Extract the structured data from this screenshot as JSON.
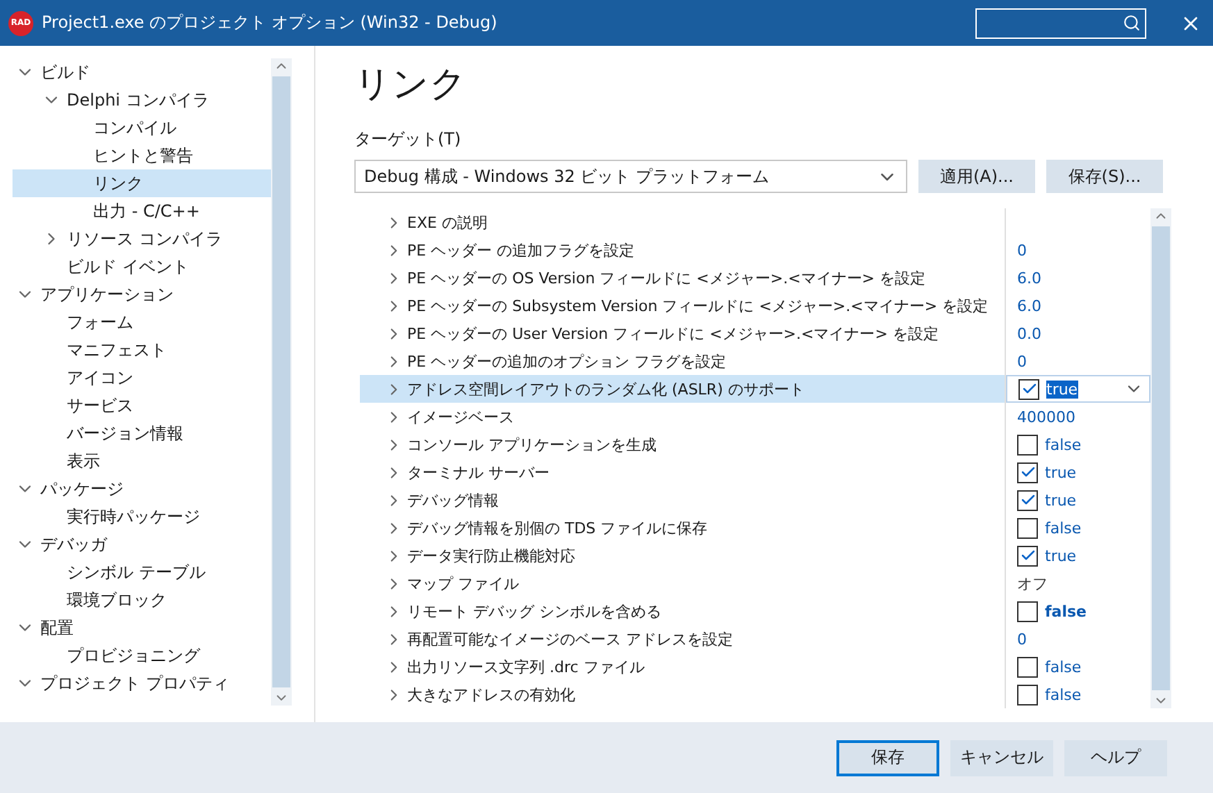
{
  "window": {
    "logo": "RAD",
    "title": "Project1.exe のプロジェクト オプション  (Win32 - Debug)"
  },
  "sidebar": {
    "items": [
      {
        "label": "ビルド",
        "selected": false,
        "expanded": true,
        "children": [
          {
            "label": "Delphi コンパイラ",
            "selected": false,
            "expanded": true,
            "children": [
              {
                "label": "コンパイル",
                "selected": false
              },
              {
                "label": "ヒントと警告",
                "selected": false
              },
              {
                "label": "リンク",
                "selected": true
              },
              {
                "label": "出力 - C/C++",
                "selected": false
              }
            ]
          },
          {
            "label": "リソース コンパイラ",
            "selected": false,
            "expanded": false
          },
          {
            "label": "ビルド イベント",
            "selected": false
          }
        ]
      },
      {
        "label": "アプリケーション",
        "selected": false,
        "expanded": true,
        "children": [
          {
            "label": "フォーム",
            "selected": false
          },
          {
            "label": "マニフェスト",
            "selected": false
          },
          {
            "label": "アイコン",
            "selected": false
          },
          {
            "label": "サービス",
            "selected": false
          },
          {
            "label": "バージョン情報",
            "selected": false
          },
          {
            "label": "表示",
            "selected": false
          }
        ]
      },
      {
        "label": "パッケージ",
        "selected": false,
        "expanded": true,
        "children": [
          {
            "label": "実行時パッケージ",
            "selected": false
          }
        ]
      },
      {
        "label": "デバッガ",
        "selected": false,
        "expanded": true,
        "children": [
          {
            "label": "シンボル テーブル",
            "selected": false
          },
          {
            "label": "環境ブロック",
            "selected": false
          }
        ]
      },
      {
        "label": "配置",
        "selected": false,
        "expanded": true,
        "children": [
          {
            "label": "プロビジョニング",
            "selected": false
          }
        ]
      },
      {
        "label": "プロジェクト プロパティ",
        "selected": false,
        "expanded": true
      }
    ]
  },
  "page": {
    "heading": "リンク",
    "target_label": "ターゲット(T)",
    "target_value": "Debug 構成 - Windows 32 ビット プラットフォーム",
    "buttons": [
      "適用(A)...",
      "保存(S)..."
    ]
  },
  "properties": [
    {
      "name": "EXE の説明",
      "kind": "none",
      "selected": false
    },
    {
      "name": "PE ヘッダー の追加フラグを設定",
      "kind": "number",
      "value": "0",
      "selected": false
    },
    {
      "name": "PE ヘッダーの OS Version フィールドに <メジャー>.<マイナー> を設定",
      "kind": "number",
      "value": "6.0",
      "selected": false
    },
    {
      "name": "PE ヘッダーの Subsystem Version フィールドに <メジャー>.<マイナー> を設定",
      "kind": "number",
      "value": "6.0",
      "selected": false
    },
    {
      "name": "PE ヘッダーの User Version フィールドに <メジャー>.<マイナー> を設定",
      "kind": "number",
      "value": "0.0",
      "selected": false
    },
    {
      "name": "PE ヘッダーの追加のオプション フラグを設定",
      "kind": "number",
      "value": "0",
      "selected": false
    },
    {
      "name": "アドレス空間レイアウトのランダム化 (ASLR) のサポート",
      "kind": "check",
      "value": "true",
      "checked": true,
      "bold": false,
      "selected": true
    },
    {
      "name": "イメージベース",
      "kind": "number",
      "value": "400000",
      "selected": false
    },
    {
      "name": "コンソール アプリケーションを生成",
      "kind": "check",
      "value": "false",
      "checked": false,
      "bold": false,
      "selected": false
    },
    {
      "name": "ターミナル サーバー",
      "kind": "check",
      "value": "true",
      "checked": true,
      "bold": false,
      "selected": false
    },
    {
      "name": "デバッグ情報",
      "kind": "check",
      "value": "true",
      "checked": true,
      "bold": false,
      "selected": false
    },
    {
      "name": "デバッグ情報を別個の TDS ファイルに保存",
      "kind": "check",
      "value": "false",
      "checked": false,
      "bold": false,
      "selected": false
    },
    {
      "name": "データ実行防止機能対応",
      "kind": "check",
      "value": "true",
      "checked": true,
      "bold": false,
      "selected": false
    },
    {
      "name": "マップ ファイル",
      "kind": "text",
      "value": "オフ",
      "selected": false
    },
    {
      "name": "リモート デバッグ シンボルを含める",
      "kind": "check",
      "value": "false",
      "checked": false,
      "bold": true,
      "selected": false
    },
    {
      "name": "再配置可能なイメージのベース アドレスを設定",
      "kind": "number",
      "value": "0",
      "selected": false
    },
    {
      "name": "出力リソース文字列 .drc ファイル",
      "kind": "check",
      "value": "false",
      "checked": false,
      "bold": false,
      "selected": false
    },
    {
      "name": "大きなアドレスの有効化",
      "kind": "check",
      "value": "false",
      "checked": false,
      "bold": false,
      "selected": false
    }
  ],
  "footer": {
    "buttons": [
      {
        "label": "保存",
        "default": true
      },
      {
        "label": "キャンセル",
        "default": false
      },
      {
        "label": "ヘルプ",
        "default": false
      }
    ]
  }
}
